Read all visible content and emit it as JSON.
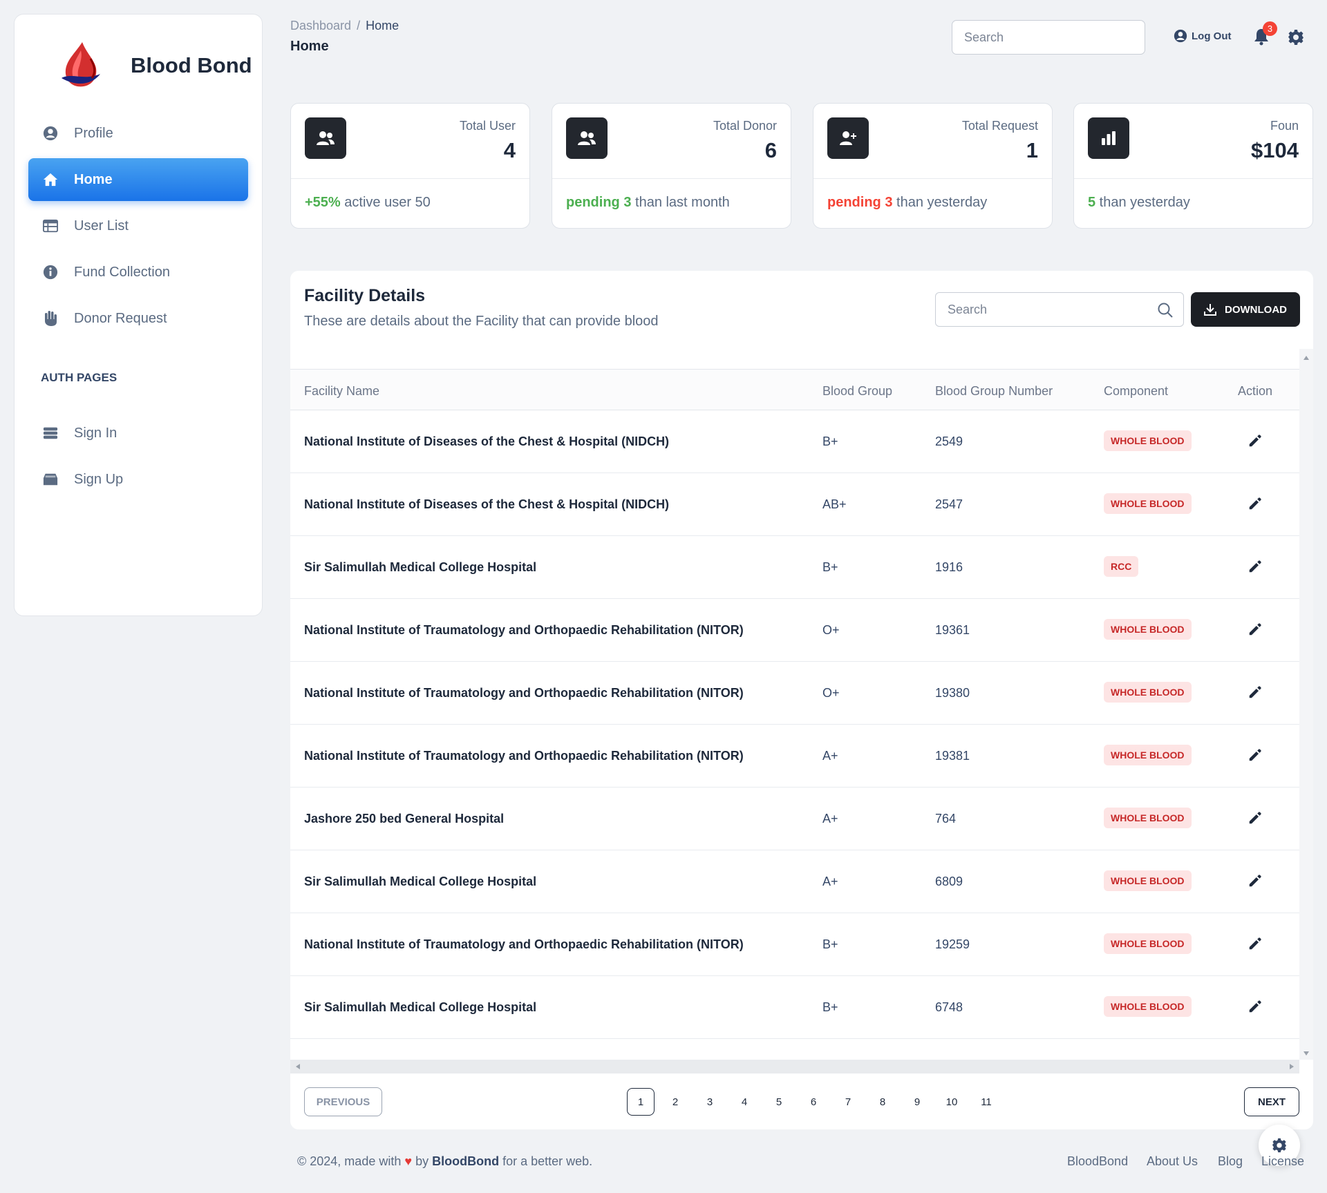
{
  "brand": {
    "name": "Blood Bond"
  },
  "sidebar": {
    "items": [
      {
        "label": "Profile",
        "icon": "user-circle-icon"
      },
      {
        "label": "Home",
        "icon": "home-icon",
        "active": true
      },
      {
        "label": "User List",
        "icon": "table-icon"
      },
      {
        "label": "Fund Collection",
        "icon": "info-icon"
      },
      {
        "label": "Donor Request",
        "icon": "hand-icon"
      }
    ],
    "section_label": "AUTH PAGES",
    "auth_items": [
      {
        "label": "Sign In",
        "icon": "database-icon"
      },
      {
        "label": "Sign Up",
        "icon": "inbox-icon"
      }
    ]
  },
  "header": {
    "breadcrumb_root": "Dashboard",
    "breadcrumb_sep": "/",
    "breadcrumb_current": "Home",
    "title": "Home",
    "search_placeholder": "Search",
    "logout_label": "Log Out",
    "notification_count": "3"
  },
  "stats": [
    {
      "label": "Total User",
      "value": "4",
      "highlight": "+55%",
      "highlight_color": "#4caf50",
      "rest": " active user 50"
    },
    {
      "label": "Total Donor",
      "value": "6",
      "highlight": "pending 3",
      "highlight_color": "#4caf50",
      "rest": " than last month"
    },
    {
      "label": "Total Request",
      "value": "1",
      "highlight": "pending 3",
      "highlight_color": "#f44335",
      "rest": " than yesterday"
    },
    {
      "label": "Foun",
      "value": "$104",
      "highlight": "5",
      "highlight_color": "#4caf50",
      "rest": " than yesterday"
    }
  ],
  "facility": {
    "title": "Facility Details",
    "subtitle": "These are details about the Facility that can provide blood",
    "search_placeholder": "Search",
    "download_label": "DOWNLOAD",
    "columns": [
      "Facility Name",
      "Blood Group",
      "Blood Group Number",
      "Component",
      "Action"
    ],
    "rows": [
      {
        "name": "National Institute of Diseases of the Chest & Hospital (NIDCH)",
        "group": "B+",
        "number": "2549",
        "component": "WHOLE BLOOD"
      },
      {
        "name": "National Institute of Diseases of the Chest & Hospital (NIDCH)",
        "group": "AB+",
        "number": "2547",
        "component": "WHOLE BLOOD"
      },
      {
        "name": "Sir Salimullah Medical College Hospital",
        "group": "B+",
        "number": "1916",
        "component": "RCC"
      },
      {
        "name": "National Institute of Traumatology and Orthopaedic Rehabilitation (NITOR)",
        "group": "O+",
        "number": "19361",
        "component": "WHOLE BLOOD"
      },
      {
        "name": "National Institute of Traumatology and Orthopaedic Rehabilitation (NITOR)",
        "group": "O+",
        "number": "19380",
        "component": "WHOLE BLOOD"
      },
      {
        "name": "National Institute of Traumatology and Orthopaedic Rehabilitation (NITOR)",
        "group": "A+",
        "number": "19381",
        "component": "WHOLE BLOOD"
      },
      {
        "name": "Jashore 250 bed General Hospital",
        "group": "A+",
        "number": "764",
        "component": "WHOLE BLOOD"
      },
      {
        "name": "Sir Salimullah Medical College Hospital",
        "group": "A+",
        "number": "6809",
        "component": "WHOLE BLOOD"
      },
      {
        "name": "National Institute of Traumatology and Orthopaedic Rehabilitation (NITOR)",
        "group": "B+",
        "number": "19259",
        "component": "WHOLE BLOOD"
      },
      {
        "name": "Sir Salimullah Medical College Hospital",
        "group": "B+",
        "number": "6748",
        "component": "WHOLE BLOOD"
      }
    ]
  },
  "pagination": {
    "previous_label": "PREVIOUS",
    "next_label": "NEXT",
    "pages": [
      "1",
      "2",
      "3",
      "4",
      "5",
      "6",
      "7",
      "8",
      "9",
      "10",
      "11"
    ],
    "current": "1"
  },
  "footer": {
    "copyright_prefix": "© 2024, made with",
    "by": "by",
    "brand": "BloodBond",
    "suffix": "for a better web.",
    "links": [
      "BloodBond",
      "About Us",
      "Blog",
      "License"
    ]
  },
  "colors": {
    "accent": "#1a73e8",
    "success": "#4caf50",
    "danger": "#f44335",
    "dark": "#1c1f24"
  }
}
